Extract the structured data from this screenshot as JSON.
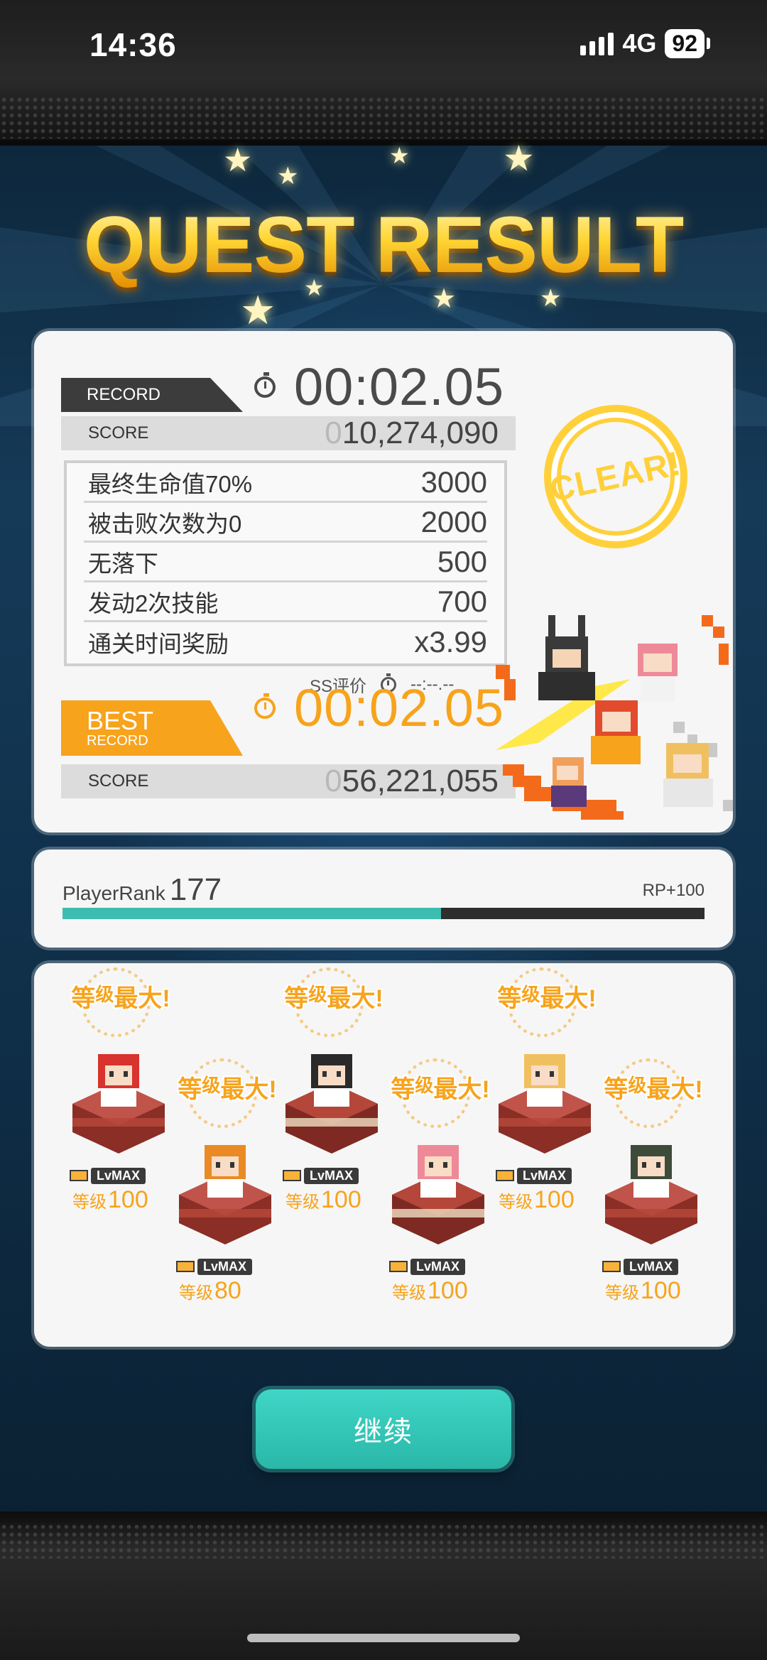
{
  "status_bar": {
    "time": "14:36",
    "network": "4G",
    "battery": "92"
  },
  "title": "QUEST RESULT",
  "record": {
    "tag": "RECORD",
    "time": "00:02.05",
    "score_label": "SCORE",
    "score_dim": "0",
    "score_value": "10,274,090"
  },
  "bonuses": [
    {
      "name": "最终生命值70%",
      "points": "3000"
    },
    {
      "name": "被击败次数为0",
      "points": "2000"
    },
    {
      "name": "无落下",
      "points": "500"
    },
    {
      "name": "发动2次技能",
      "points": "700"
    },
    {
      "name": "通关时间奖励",
      "points": "x3.99"
    }
  ],
  "ss_rating": {
    "label": "SS评价",
    "time": "--:--.--"
  },
  "best_record": {
    "tag_big": "BEST",
    "tag_small": "RECORD",
    "time": "00:02.05",
    "score_label": "SCORE",
    "score_dim": "0",
    "score_value": "56,221,055"
  },
  "clear_stamp": "CLEAR!",
  "player_rank": {
    "label": "PlayerRank",
    "value": "177",
    "rp": "RP+100",
    "progress": 0.59
  },
  "units": [
    {
      "badge_a": "等",
      "badge_k": "级",
      "badge_b": "最大!",
      "lvmax": "LvMAX",
      "level_label": "等级",
      "level": "100",
      "hair": "#d8332e",
      "pedestal": "red"
    },
    {
      "badge_a": "等",
      "badge_k": "级",
      "badge_b": "最大!",
      "lvmax": "LvMAX",
      "level_label": "等级",
      "level": "80",
      "hair": "#e98a25",
      "pedestal": "red"
    },
    {
      "badge_a": "等",
      "badge_k": "级",
      "badge_b": "最大!",
      "lvmax": "LvMAX",
      "level_label": "等级",
      "level": "100",
      "hair": "#2a2a2a",
      "pedestal": "cream"
    },
    {
      "badge_a": "等",
      "badge_k": "级",
      "badge_b": "最大!",
      "lvmax": "LvMAX",
      "level_label": "等级",
      "level": "100",
      "hair": "#ee8a98",
      "pedestal": "cream"
    },
    {
      "badge_a": "等",
      "badge_k": "级",
      "badge_b": "最大!",
      "lvmax": "LvMAX",
      "level_label": "等级",
      "level": "100",
      "hair": "#f0c060",
      "pedestal": "red"
    },
    {
      "badge_a": "等",
      "badge_k": "级",
      "badge_b": "最大!",
      "lvmax": "LvMAX",
      "level_label": "等级",
      "level": "100",
      "hair": "#3e4a3a",
      "pedestal": "red"
    }
  ],
  "continue_button": "继续",
  "colors": {
    "accent": "#f7a31c",
    "teal": "#3dbdb0",
    "clear": "#ffd03a"
  }
}
